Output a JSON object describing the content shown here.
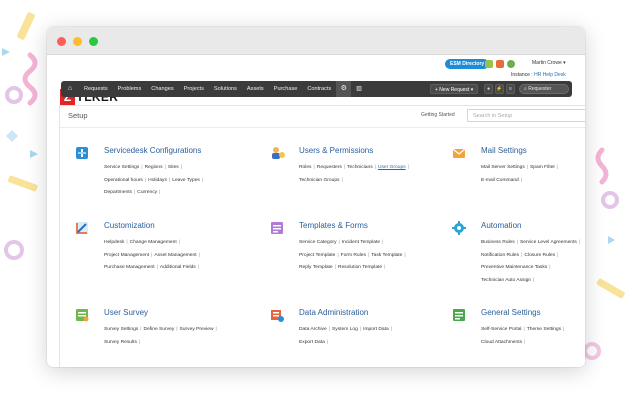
{
  "app": {
    "logo_mark": "Z",
    "logo_text": "YLKER",
    "esm_button": "ESM Directory",
    "user_name": "Martin Crowe ▾",
    "instance_label": "Instance :",
    "instance_value": "HR Help Desk"
  },
  "nav": {
    "items": [
      "Requests",
      "Problems",
      "Changes",
      "Projects",
      "Solutions",
      "Assets",
      "Purchase",
      "Contracts"
    ],
    "new_request": "+ New Request ▾",
    "search_placeholder": "Requester"
  },
  "setup": {
    "title": "Setup",
    "getting_started": "Getting Started",
    "search_placeholder": "Search in Setup"
  },
  "colors": {
    "brand_red": "#e42527",
    "nav_bg": "#3b3b3b",
    "section_title": "#2a5f9c",
    "esm_blue": "#1d8bd7"
  },
  "sections": [
    {
      "title": "Servicedesk Configurations",
      "icon": "servicedesk-icon",
      "rows": [
        [
          "Service Settings",
          "Regions",
          "Sites"
        ],
        [
          "Operational hours",
          "Holidays",
          "Leave Types"
        ],
        [
          "Departments",
          "Currency"
        ]
      ]
    },
    {
      "title": "Users & Permissions",
      "icon": "users-icon",
      "rows": [
        [
          "Roles",
          "Requesters",
          "Technicians",
          "User Groups"
        ],
        [
          "Technician Groups"
        ]
      ]
    },
    {
      "title": "Mail Settings",
      "icon": "mail-icon",
      "rows": [
        [
          "Mail Server Settings",
          "Spam Filter"
        ],
        [
          "E-mail Command"
        ]
      ]
    },
    {
      "title": "Customization",
      "icon": "customization-icon",
      "rows": [
        [
          "Helpdesk",
          "Change Management"
        ],
        [
          "Project Management",
          "Asset Management"
        ],
        [
          "Purchase Management",
          "Additional Fields"
        ]
      ]
    },
    {
      "title": "Templates & Forms",
      "icon": "templates-icon",
      "rows": [
        [
          "Service Category",
          "Incident Template"
        ],
        [
          "Project Template",
          "Form Rules",
          "Task Template"
        ],
        [
          "Reply Template",
          "Resolution Template"
        ]
      ]
    },
    {
      "title": "Automation",
      "icon": "automation-icon",
      "rows": [
        [
          "Business Rules",
          "Service Level Agreements"
        ],
        [
          "Notification Rules",
          "Closure Rules"
        ],
        [
          "Preventive Maintenance Tasks"
        ],
        [
          "Technician Auto Assign"
        ]
      ]
    },
    {
      "title": "User Survey",
      "icon": "survey-icon",
      "rows": [
        [
          "Survey Settings",
          "Define Survey",
          "Survey Preview"
        ],
        [
          "Survey Results"
        ]
      ]
    },
    {
      "title": "Data Administration",
      "icon": "data-admin-icon",
      "rows": [
        [
          "Data Archive",
          "System Log",
          "Import Data"
        ],
        [
          "Export Data"
        ]
      ]
    },
    {
      "title": "General Settings",
      "icon": "general-settings-icon",
      "rows": [
        [
          "Self-Service Portal",
          "Theme Settings"
        ],
        [
          "Cloud Attachments"
        ]
      ]
    }
  ]
}
